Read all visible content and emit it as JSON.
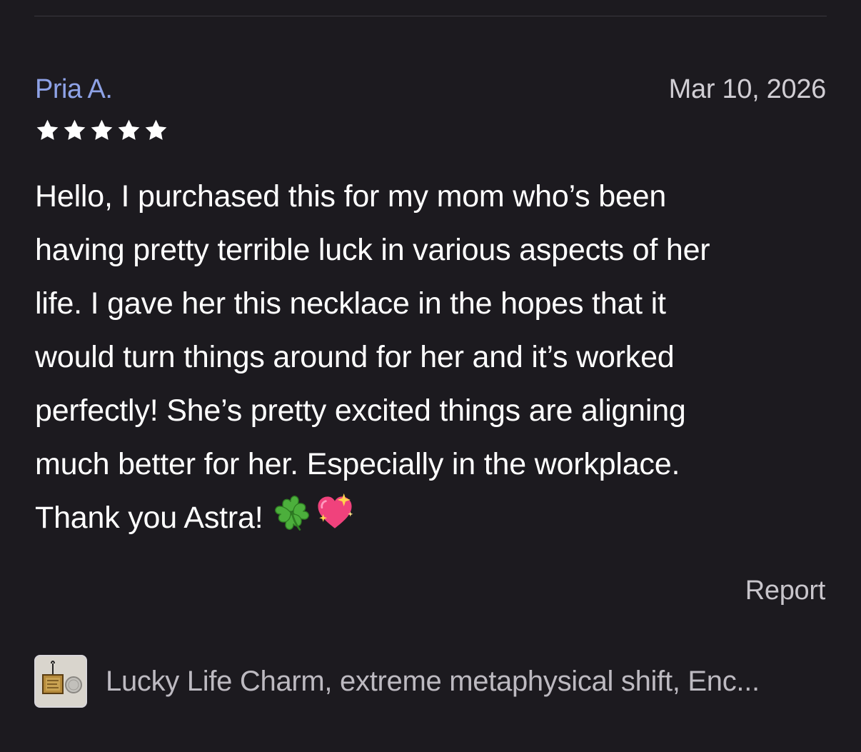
{
  "review": {
    "author": "Pria A.",
    "date": "Mar 10, 2026",
    "rating": 5,
    "rating_max": 5,
    "text_lines": [
      "Hello, I purchased this for my mom who’s been",
      "having pretty terrible luck in various aspects of her",
      "life. I gave her this necklace in the hopes that it",
      "would turn things around for her and it’s worked",
      "perfectly! She’s pretty excited things are aligning",
      "much better for her. Especially in the workplace.",
      "Thank you Astra!"
    ],
    "emojis": [
      "four-leaf-clover-icon",
      "sparkling-heart-icon"
    ],
    "report_label": "Report"
  },
  "product": {
    "title": "Lucky Life Charm, extreme metaphysical shift, Enc...",
    "thumbnail_icon": "product-thumbnail"
  },
  "colors": {
    "background": "#1c1a1f",
    "author": "#8ea2e6",
    "text": "#ffffff",
    "muted": "#c8c5cb",
    "heart": "#f0427c",
    "clover": "#4caf3c"
  }
}
